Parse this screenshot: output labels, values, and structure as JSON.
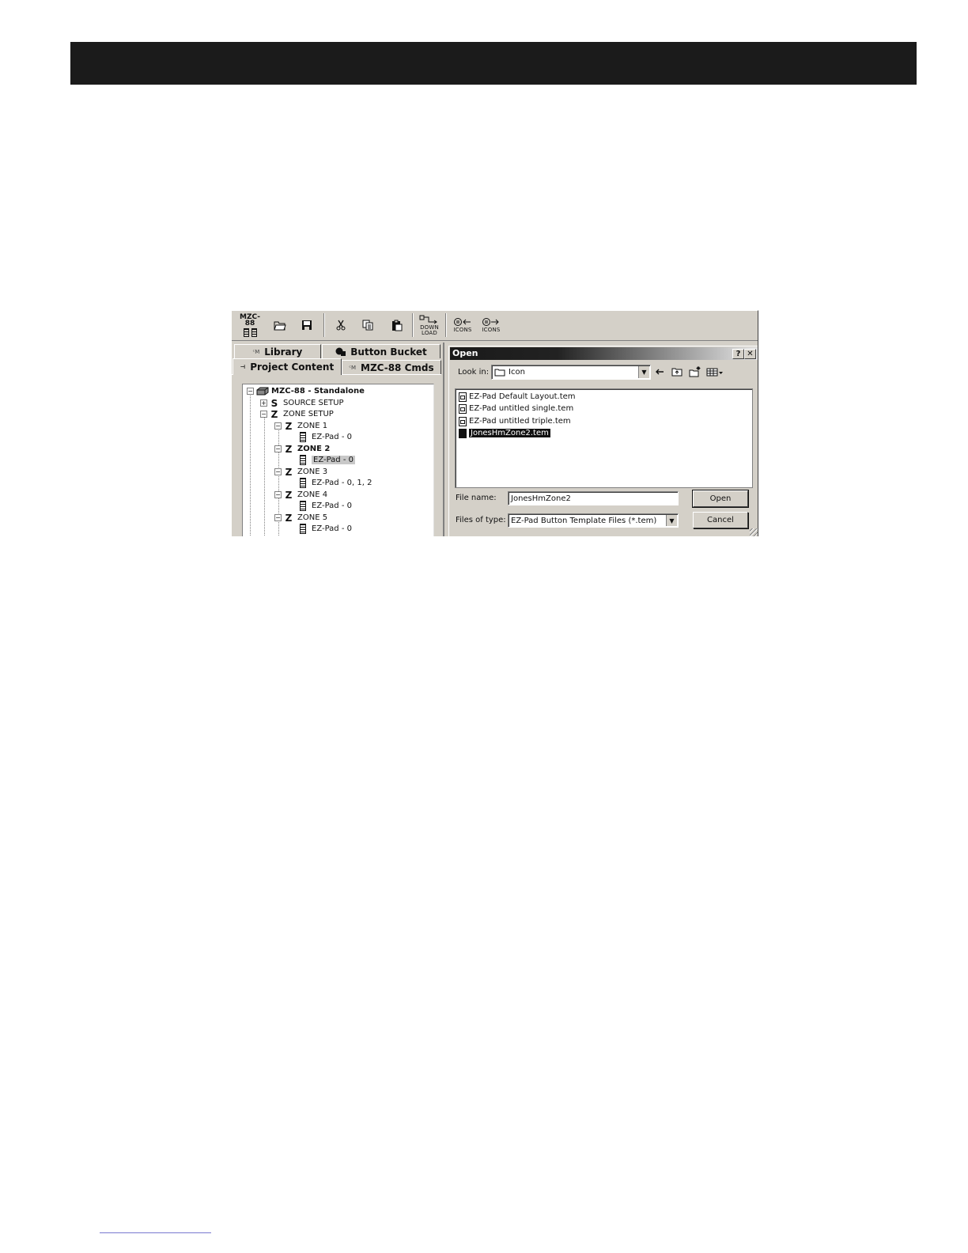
{
  "toolbar": {
    "mzc_label": "MZC-88",
    "download_label": "DOWN LOAD",
    "icons_in_label": "ICONS",
    "icons_out_label": "ICONS"
  },
  "tabs": {
    "library": "Library",
    "button_bucket": "Button Bucket",
    "project_content": "Project Content",
    "mzc_cmds": "MZC-88 Cmds"
  },
  "tree": {
    "root": "MZC-88 - Standalone",
    "source_setup": "SOURCE SETUP",
    "zone_setup": "ZONE SETUP",
    "zones": [
      {
        "label": "ZONE 1",
        "child": "EZ-Pad - 0"
      },
      {
        "label": "ZONE 2",
        "child": "EZ-Pad - 0"
      },
      {
        "label": "ZONE 3",
        "child": "EZ-Pad - 0, 1, 2"
      },
      {
        "label": "ZONE 4",
        "child": "EZ-Pad - 0"
      },
      {
        "label": "ZONE 5",
        "child": "EZ-Pad - 0"
      }
    ]
  },
  "dialog": {
    "title": "Open",
    "help": "?",
    "close": "✕",
    "look_in_label": "Look in:",
    "look_in_value": "Icon",
    "files": [
      "EZ-Pad Default Layout.tem",
      "EZ-Pad untitled single.tem",
      "EZ-Pad untitled triple.tem",
      "JonesHmZone2.tem"
    ],
    "file_name_label": "File name:",
    "file_name_value": "JonesHmZone2",
    "file_type_label": "Files of type:",
    "file_type_value": "EZ-Pad Button Template Files (*.tem)",
    "open_button": "Open",
    "cancel_button": "Cancel"
  }
}
